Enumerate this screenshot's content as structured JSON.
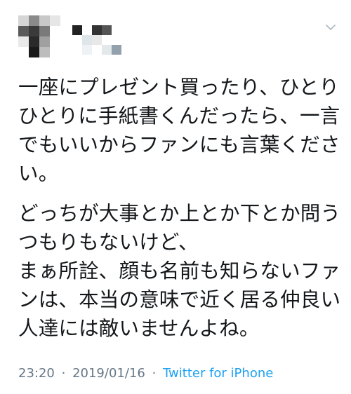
{
  "tweet": {
    "author_name": "",
    "text_paragraphs": [
      "一座にプレゼント買ったり、ひとりひとりに手紙書くんだったら、一言でもいいからファンにも言葉ください。",
      "どっちが大事とか上とか下とか問うつもりもないけど、\nまぁ所詮、顔も名前も知らないファンは、本当の意味で近く居る仲良い人達には敵いませんよね。"
    ],
    "time": "23:20",
    "separator": "·",
    "date": "2019/01/16",
    "source": "Twitter for iPhone"
  },
  "icons": {
    "menu_caret": "chevron-down-icon",
    "avatar": "avatar"
  },
  "colors": {
    "text": "#14171a",
    "meta_gray": "#657786",
    "link_blue": "#1da1f2",
    "caret_gray": "#aab8c2"
  }
}
